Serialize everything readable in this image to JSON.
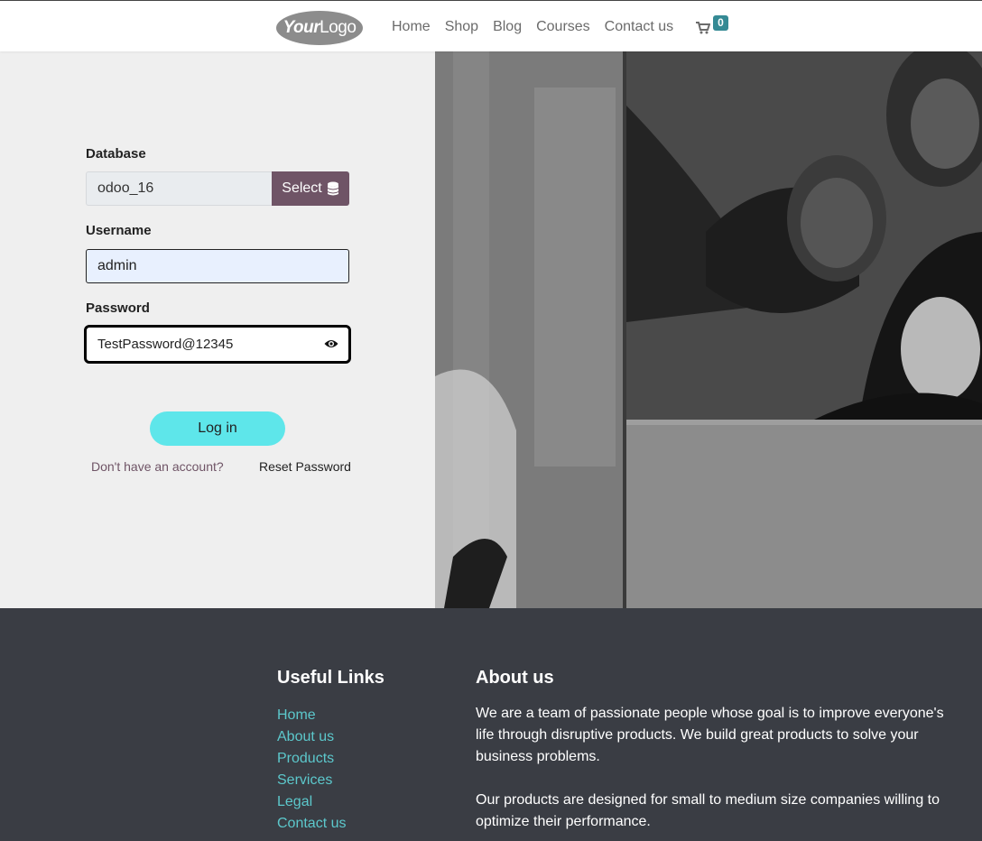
{
  "header": {
    "logo": {
      "bold": "Your",
      "light": "Logo"
    },
    "nav": [
      "Home",
      "Shop",
      "Blog",
      "Courses",
      "Contact us"
    ],
    "cart_count": "0"
  },
  "login": {
    "database_label": "Database",
    "database_value": "odoo_16",
    "select_label": "Select",
    "username_label": "Username",
    "username_value": "admin",
    "password_label": "Password",
    "password_value": "TestPassword@12345",
    "login_button": "Log in",
    "signup_link": "Don't have an account?",
    "reset_link": "Reset Password"
  },
  "footer": {
    "links_title": "Useful Links",
    "links": [
      "Home",
      "About us",
      "Products",
      "Services",
      "Legal",
      "Contact us"
    ],
    "about_title": "About us",
    "about_paragraphs": [
      "We are a team of passionate people whose goal is to improve everyone's life through disruptive products. We build great products to solve your business problems.",
      "Our products are designed for small to medium size companies willing to optimize their performance."
    ]
  },
  "colors": {
    "accent_primary": "#6f5466",
    "login_button": "#5ee6ea",
    "footer_bg": "#3a3d44",
    "footer_link": "#5cc8cc",
    "cart_badge": "#358a94"
  },
  "icons": [
    "cart-icon",
    "database-icon",
    "eye-icon"
  ]
}
